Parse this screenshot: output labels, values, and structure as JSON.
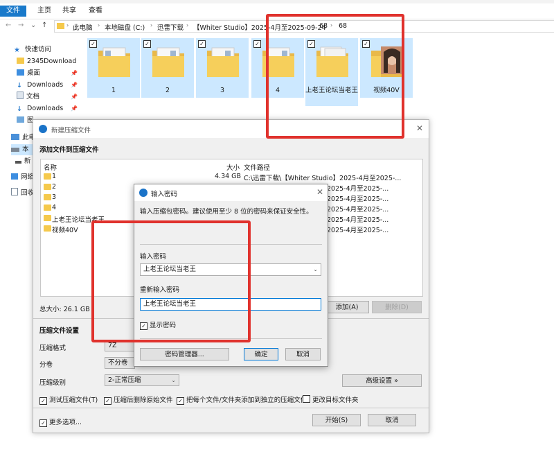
{
  "explorer": {
    "ribbon_tabs": [
      "文件",
      "主页",
      "共享",
      "查看"
    ],
    "breadcrumb": [
      "此电脑",
      "本地磁盘 (C:)",
      "迅雷下载",
      "【Whiter Studio】2025-4月至2025-09-24",
      "68",
      "68"
    ],
    "sidebar": [
      {
        "label": "快速访问"
      },
      {
        "label": "2345Download"
      },
      {
        "label": "桌面"
      },
      {
        "label": "Downloads"
      },
      {
        "label": "文档"
      },
      {
        "label": "Downloads"
      },
      {
        "label": "图"
      },
      {
        "label": "此电"
      },
      {
        "label": "本"
      },
      {
        "label": "新"
      },
      {
        "label": "网络"
      },
      {
        "label": "回收"
      }
    ],
    "items": [
      {
        "name": "1"
      },
      {
        "name": "2"
      },
      {
        "name": "3"
      },
      {
        "name": "4"
      },
      {
        "name": "上老王论坛当老王"
      },
      {
        "name": "视频40V"
      }
    ]
  },
  "compress_dialog": {
    "title": "新建压缩文件",
    "section_add": "添加文件到压缩文件",
    "columns": {
      "name": "名称",
      "size": "大小",
      "path": "文件路径"
    },
    "rows": [
      {
        "name": "1",
        "size": "4.34 GB",
        "path": "C:\\迅雷下载\\【Whiter Studio】2025-4月至2025-..."
      },
      {
        "name": "2",
        "size": "",
        "path": "2025-4月至2025-..."
      },
      {
        "name": "3",
        "size": "",
        "path": "2025-4月至2025-..."
      },
      {
        "name": "4",
        "size": "",
        "path": "2025-4月至2025-..."
      },
      {
        "name": "上老王论坛当老王",
        "size": "",
        "path": "2025-4月至2025-..."
      },
      {
        "name": "视频40V",
        "size": "",
        "path": "2025-4月至2025-..."
      }
    ],
    "total_size": "总大小: 26.1 GB",
    "add_button": "添加(A)",
    "delete_button": "删除(D)",
    "section_settings": "压缩文件设置",
    "format_label": "压缩格式",
    "format_value": "7Z",
    "split_label": "分卷",
    "split_value": "不分卷",
    "level_label": "压缩级别",
    "level_value": "2-正常压缩",
    "advanced_button": "高级设置 »",
    "checks": [
      {
        "label": "测试压缩文件(T)",
        "checked": true
      },
      {
        "label": "压缩后删除原始文件",
        "checked": true
      },
      {
        "label": "把每个文件/文件夹添加到独立的压缩文件",
        "checked": true
      },
      {
        "label": "更改目标文件夹",
        "checked": false
      }
    ],
    "more_options": "更多选项...",
    "start_button": "开始(S)",
    "cancel_button": "取消"
  },
  "password_dialog": {
    "title": "输入密码",
    "description": "输入压缩包密码。建议使用至少 8 位的密码来保证安全性。",
    "password_label": "输入密码",
    "password_value": "上老王论坛当老王",
    "reenter_label": "重新输入密码",
    "reenter_value": "上老王论坛当老王",
    "show_password": "显示密码",
    "manager_button": "密码管理器...",
    "ok_button": "确定",
    "cancel_button": "取消"
  },
  "colors": {
    "accent": "#1979ca",
    "highlight": "#e0322d",
    "selection": "#cce8ff",
    "folder": "#f5c94c"
  }
}
